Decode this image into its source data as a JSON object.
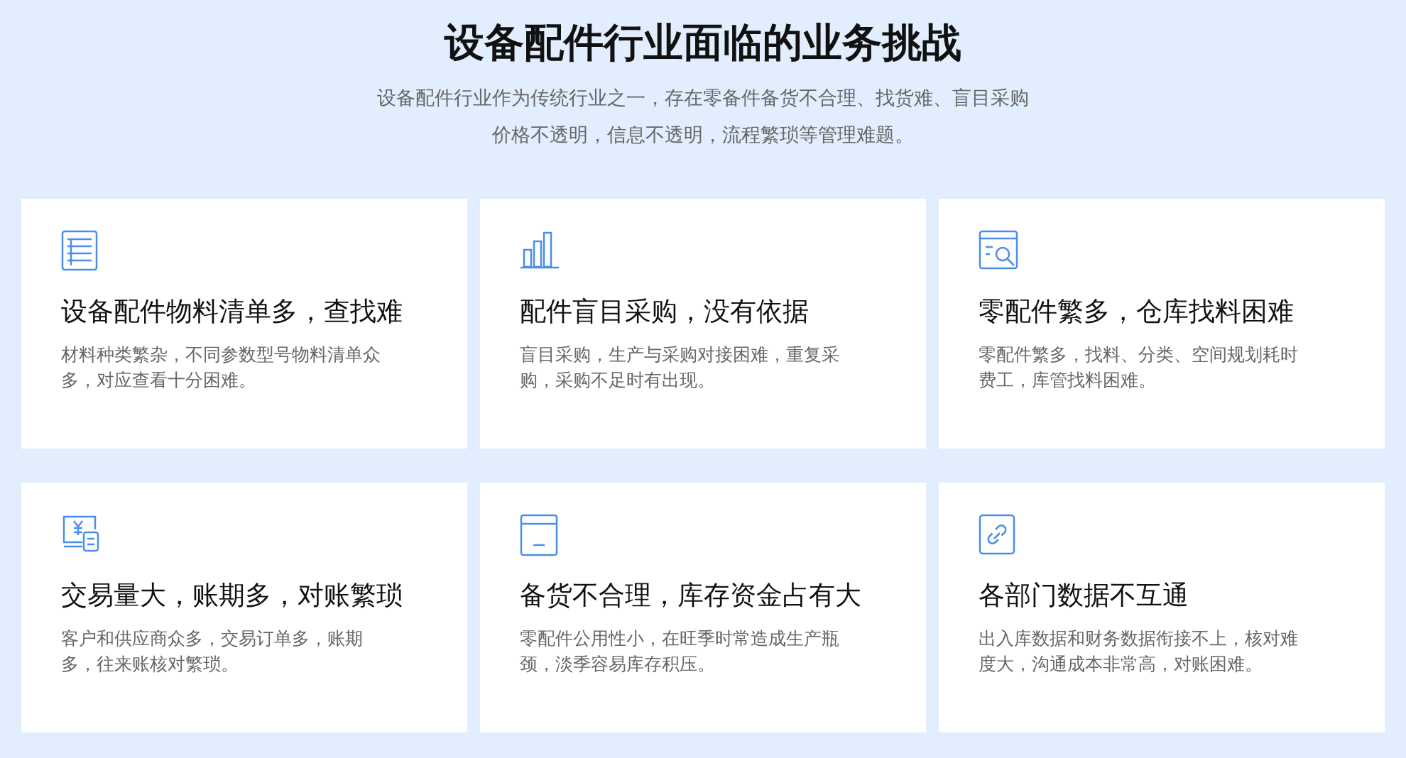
{
  "heading": "设备配件行业面临的业务挑战",
  "intro_lines": [
    "设备配件行业作为传统行业之一，存在零备件备货不合理、找货难、盲目采购",
    "价格不透明，信息不透明，流程繁琐等管理难题。"
  ],
  "cards": [
    {
      "title": "设备配件物料清单多，查找难",
      "description": "材料种类繁杂，不同参数型号物料清单众多，对应查看十分困难。"
    },
    {
      "title": "配件盲目采购，没有依据",
      "description": "盲目采购，生产与采购对接困难，重复采购，采购不足时有出现。"
    },
    {
      "title": "零配件繁多，仓库找料困难",
      "description": "零配件繁多，找料、分类、空间规划耗时费工，库管找料困难。"
    },
    {
      "title": "交易量大，账期多，对账繁琐",
      "description": "客户和供应商众多，交易订单多，账期多，往来账核对繁琐。"
    },
    {
      "title": "备货不合理，库存资金占有大",
      "description": "零配件公用性小，在旺季时常造成生产瓶颈，淡季容易库存积压。"
    },
    {
      "title": "各部门数据不互通",
      "description": "出入库数据和财务数据衔接不上，核对难度大，沟通成本非常高，对账困难。"
    }
  ]
}
